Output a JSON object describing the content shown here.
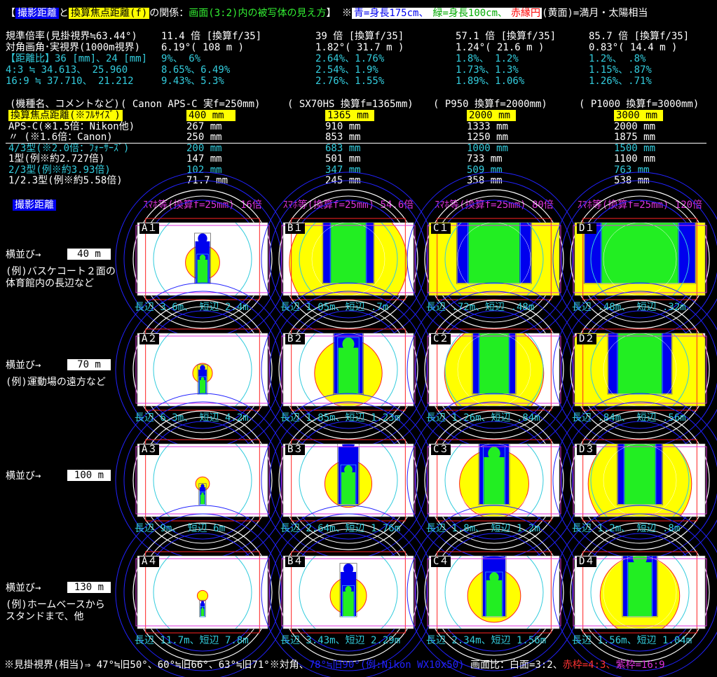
{
  "title": {
    "open": "【",
    "shooting_distance": "撮影距離",
    "and": "と",
    "focal": "換算焦点距離(f)",
    "relation": "の関係：",
    "screen": "画面(3:2)内の被写体の見え方",
    "note": "】 ※",
    "blue": "青=身長175cm、",
    "green": "緑=身長100cm、",
    "red": "赤縁円",
    "rest": "(黄面)=満月・太陽相当"
  },
  "stats": {
    "rows": [
      {
        "label": "規準倍率(見掛視界≒63.44°)",
        "cols": [
          "11.4 倍 [換算f/35]",
          "39 倍 [換算f/35]",
          "57.1 倍 [換算f/35]",
          "85.7 倍 [換算f/35]"
        ],
        "color": "white"
      },
      {
        "label": "対角画角･実視界(1000m視界)",
        "cols": [
          "6.19°( 108 m )",
          "1.82°( 31.7 m )",
          "1.24°( 21.6 m )",
          "0.83°( 14.4 m )"
        ],
        "color": "white"
      },
      {
        "label": "【距離比】36 [mm]、24 [mm]",
        "cols": [
          "9%、  6%",
          "2.64%、1.76%",
          "1.8%、 1.2%",
          "1.2%、 .8%"
        ],
        "color": "cyan"
      },
      {
        "label": "  4:3 ≒ 34.613、 25.960",
        "cols": [
          "8.65%、6.49%",
          "2.54%、1.9%",
          "1.73%、1.3%",
          "1.15%、.87%"
        ],
        "color": "cyan"
      },
      {
        "label": " 16:9 ≒ 37.710、 21.212",
        "cols": [
          "9.43%、5.3%",
          "2.76%、1.55%",
          "1.89%、1.06%",
          "1.26%、.71%"
        ],
        "color": "cyan"
      }
    ]
  },
  "models": {
    "header": "(機種名、コメントなど)",
    "names": [
      "( Canon APS-C 実f=250mm)",
      "( SX70HS 換算f=1365mm)",
      "( P950 換算f=2000mm)",
      "( P1000 換算f=3000mm)"
    ],
    "rows": [
      {
        "label": "換算焦点距離(※ﾌﾙｻｲｽﾞ)",
        "cols": [
          "400 mm",
          "1365 mm",
          "2000 mm",
          "3000 mm"
        ],
        "color": "yellow"
      },
      {
        "label": " APS-C(※1.5倍：Nikon他)",
        "cols": [
          "267 mm",
          "910 mm",
          "1333 mm",
          "2000 mm"
        ],
        "color": "white"
      },
      {
        "label": "   〃 (※1.6倍：Canon)",
        "cols": [
          "250 mm",
          "853 mm",
          "1250 mm",
          "1875 mm"
        ],
        "color": "white"
      },
      {
        "label": " 4/3型(※2.0倍：ﾌｫｰｻｰｽﾞ)",
        "cols": [
          "200 mm",
          "683 mm",
          "1000 mm",
          "1500 mm"
        ],
        "color": "cyan"
      },
      {
        "label": "  1型(例※約2.727倍)",
        "cols": [
          "147 mm",
          "501 mm",
          "733 mm",
          "1100 mm"
        ],
        "color": "white"
      },
      {
        "label": " 2/3型(例※約3.93倍)",
        "cols": [
          "102 mm",
          "347 mm",
          "509 mm",
          "763 mm"
        ],
        "color": "cyan"
      },
      {
        "label": " 1/2.3型(例※約5.58倍)",
        "cols": [
          "71.7 mm",
          "245 mm",
          "358 mm",
          "538 mm"
        ],
        "color": "white"
      }
    ]
  },
  "grid": {
    "distance_label": "撮影距離",
    "col_headers": [
      "ｽﾏﾎ等(換算f=25mm) 16倍",
      "ｽﾏﾎ等(換算f=25mm) 54.6倍",
      "ｽﾏﾎ等(換算f=25mm) 80倍",
      "ｽﾏﾎ等(換算f=25mm) 120倍"
    ],
    "rows": [
      {
        "arrow": "横並び→",
        "distance": "40 m",
        "notes": [
          "(例)バスケコート２面の",
          "   体育館内の長辺など"
        ],
        "cells": [
          "A１",
          "B１",
          "C１",
          "D１"
        ],
        "sizes": [
          "長辺 3.6m、 短辺 2.4m",
          "長辺 1.05m、短辺 .7m",
          "長辺 .72m、短辺 .48m",
          "長辺 .48m、 短辺 .32m"
        ]
      },
      {
        "arrow": "横並び→",
        "distance": "70 m",
        "notes": [
          "(例)運動場の遠方など"
        ],
        "cells": [
          "A２",
          "B２",
          "C２",
          "D２"
        ],
        "sizes": [
          "長辺 6.3m、 短辺 4.2m",
          "長辺 1.85m、短辺 1.23m",
          "長辺 1.26m、短辺 .84m",
          "長辺 .84m、 短辺 .56m"
        ]
      },
      {
        "arrow": "横並び→",
        "distance": "100 m",
        "notes": [],
        "cells": [
          "A３",
          "B３",
          "C３",
          "D３"
        ],
        "sizes": [
          "長辺 9m、 短辺 6m",
          "長辺 2.64m、短辺 1.76m",
          "長辺 1.8m、 短辺 1.2m",
          "長辺 1.2m、 短辺 .8m"
        ]
      },
      {
        "arrow": "横並び→",
        "distance": "130 m",
        "notes": [
          "(例)ホームベースから",
          "    スタンドまで、他"
        ],
        "cells": [
          "A４",
          "B４",
          "C４",
          "D４"
        ],
        "sizes": [
          "長辺 11.7m、短辺 7.8m",
          "長辺 3.43m、短辺 2.29m",
          "長辺 2.34m、短辺 1.56m",
          "長辺 1.56m、短辺 1.04m"
        ]
      }
    ],
    "scales": [
      [
        4,
        13.8,
        20.2,
        30.3
      ],
      [
        2.3,
        7.9,
        11.6,
        17.3
      ],
      [
        1.62,
        5.5,
        8.1,
        12.1
      ],
      [
        1.24,
        4.25,
        6.2,
        9.3
      ]
    ]
  },
  "footer": {
    "a": "※見掛視界(相当)⇒ 47°≒旧50°、60°≒旧66°、63°≒旧71°※対角、",
    "b": "78°≒旧90°(例:Nikon WX10x50)",
    "c": " 画面比：白面=3:2、",
    "d": "赤枠=4:3、",
    "e": "紫枠=16:9"
  },
  "colors": {
    "blue": "#0000ee",
    "green": "#22ee22",
    "yellow": "#ffff00",
    "cyan": "#33ccdd",
    "magenta": "#dd33dd",
    "red": "#ff2222"
  }
}
